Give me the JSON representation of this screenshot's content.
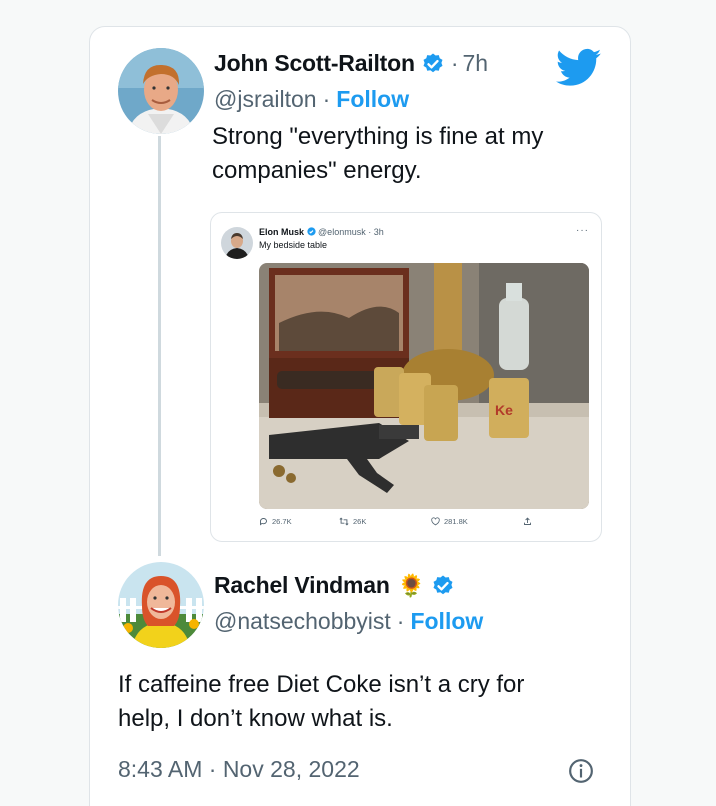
{
  "tweet": {
    "author_name": "John Scott-Railton",
    "time_sep": "·",
    "time": "7h",
    "handle": "@jsrailton",
    "follow_sep": "·",
    "follow_label": "Follow",
    "text_line1": "Strong \"everything is fine at my",
    "text_line2": "companies\" energy."
  },
  "quoted_image": {
    "author_name": "Elon Musk",
    "handle_time": "@elonmusk · 3h",
    "text": "My bedside table",
    "more": "···",
    "replies": "26.7K",
    "retweets": "26K",
    "likes": "281.8K"
  },
  "reply": {
    "author_name": "Rachel Vindman",
    "emoji": "🌻",
    "handle": "@natsechobbyist",
    "follow_sep": "·",
    "follow_label": "Follow",
    "text_line1": "If caffeine free Diet Coke isn’t a cry for",
    "text_line2": "help, I don’t know what is.",
    "timestamp": "8:43 AM · Nov 28, 2022"
  },
  "colors": {
    "accent": "#1d9bf0",
    "text": "#0f1419",
    "muted": "#536471"
  },
  "icons": [
    "verified-badge-icon",
    "twitter-bird-icon",
    "reply-icon",
    "retweet-icon",
    "like-icon",
    "share-icon",
    "info-icon"
  ]
}
